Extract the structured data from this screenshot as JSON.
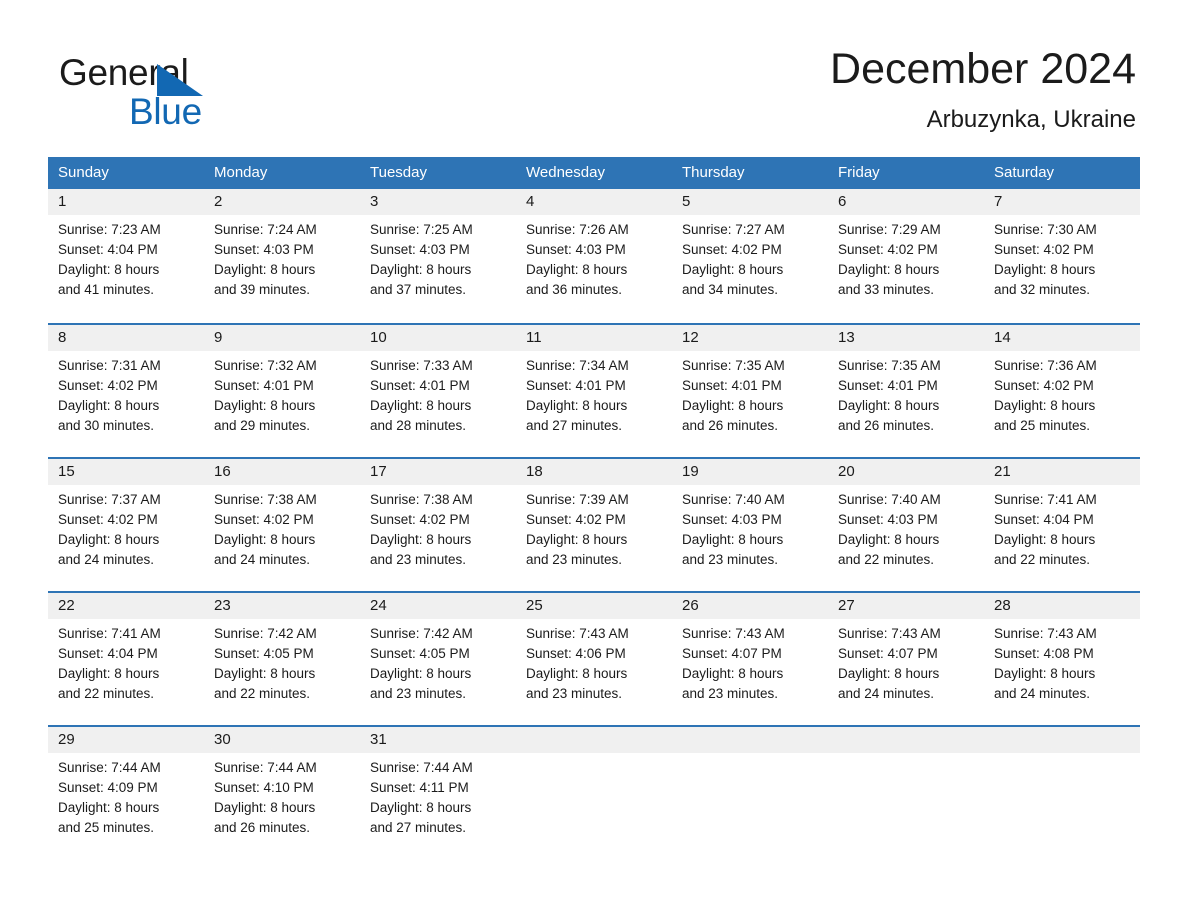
{
  "brand": {
    "name_part1": "General",
    "name_part2": "Blue",
    "triangle_color": "#1268b3",
    "logo_icon": "triangle-flag-icon"
  },
  "header": {
    "title": "December 2024",
    "subtitle": "Arbuzynka, Ukraine"
  },
  "calendar": {
    "header_bg": "#2e74b5",
    "header_text_color": "#ffffff",
    "daynumber_band_bg": "#f0f0f0",
    "weekdays": [
      "Sunday",
      "Monday",
      "Tuesday",
      "Wednesday",
      "Thursday",
      "Friday",
      "Saturday"
    ],
    "weeks": [
      [
        {
          "day": "1",
          "sunrise": "Sunrise: 7:23 AM",
          "sunset": "Sunset: 4:04 PM",
          "daylight_line1": "Daylight: 8 hours",
          "daylight_line2": "and 41 minutes."
        },
        {
          "day": "2",
          "sunrise": "Sunrise: 7:24 AM",
          "sunset": "Sunset: 4:03 PM",
          "daylight_line1": "Daylight: 8 hours",
          "daylight_line2": "and 39 minutes."
        },
        {
          "day": "3",
          "sunrise": "Sunrise: 7:25 AM",
          "sunset": "Sunset: 4:03 PM",
          "daylight_line1": "Daylight: 8 hours",
          "daylight_line2": "and 37 minutes."
        },
        {
          "day": "4",
          "sunrise": "Sunrise: 7:26 AM",
          "sunset": "Sunset: 4:03 PM",
          "daylight_line1": "Daylight: 8 hours",
          "daylight_line2": "and 36 minutes."
        },
        {
          "day": "5",
          "sunrise": "Sunrise: 7:27 AM",
          "sunset": "Sunset: 4:02 PM",
          "daylight_line1": "Daylight: 8 hours",
          "daylight_line2": "and 34 minutes."
        },
        {
          "day": "6",
          "sunrise": "Sunrise: 7:29 AM",
          "sunset": "Sunset: 4:02 PM",
          "daylight_line1": "Daylight: 8 hours",
          "daylight_line2": "and 33 minutes."
        },
        {
          "day": "7",
          "sunrise": "Sunrise: 7:30 AM",
          "sunset": "Sunset: 4:02 PM",
          "daylight_line1": "Daylight: 8 hours",
          "daylight_line2": "and 32 minutes."
        }
      ],
      [
        {
          "day": "8",
          "sunrise": "Sunrise: 7:31 AM",
          "sunset": "Sunset: 4:02 PM",
          "daylight_line1": "Daylight: 8 hours",
          "daylight_line2": "and 30 minutes."
        },
        {
          "day": "9",
          "sunrise": "Sunrise: 7:32 AM",
          "sunset": "Sunset: 4:01 PM",
          "daylight_line1": "Daylight: 8 hours",
          "daylight_line2": "and 29 minutes."
        },
        {
          "day": "10",
          "sunrise": "Sunrise: 7:33 AM",
          "sunset": "Sunset: 4:01 PM",
          "daylight_line1": "Daylight: 8 hours",
          "daylight_line2": "and 28 minutes."
        },
        {
          "day": "11",
          "sunrise": "Sunrise: 7:34 AM",
          "sunset": "Sunset: 4:01 PM",
          "daylight_line1": "Daylight: 8 hours",
          "daylight_line2": "and 27 minutes."
        },
        {
          "day": "12",
          "sunrise": "Sunrise: 7:35 AM",
          "sunset": "Sunset: 4:01 PM",
          "daylight_line1": "Daylight: 8 hours",
          "daylight_line2": "and 26 minutes."
        },
        {
          "day": "13",
          "sunrise": "Sunrise: 7:35 AM",
          "sunset": "Sunset: 4:01 PM",
          "daylight_line1": "Daylight: 8 hours",
          "daylight_line2": "and 26 minutes."
        },
        {
          "day": "14",
          "sunrise": "Sunrise: 7:36 AM",
          "sunset": "Sunset: 4:02 PM",
          "daylight_line1": "Daylight: 8 hours",
          "daylight_line2": "and 25 minutes."
        }
      ],
      [
        {
          "day": "15",
          "sunrise": "Sunrise: 7:37 AM",
          "sunset": "Sunset: 4:02 PM",
          "daylight_line1": "Daylight: 8 hours",
          "daylight_line2": "and 24 minutes."
        },
        {
          "day": "16",
          "sunrise": "Sunrise: 7:38 AM",
          "sunset": "Sunset: 4:02 PM",
          "daylight_line1": "Daylight: 8 hours",
          "daylight_line2": "and 24 minutes."
        },
        {
          "day": "17",
          "sunrise": "Sunrise: 7:38 AM",
          "sunset": "Sunset: 4:02 PM",
          "daylight_line1": "Daylight: 8 hours",
          "daylight_line2": "and 23 minutes."
        },
        {
          "day": "18",
          "sunrise": "Sunrise: 7:39 AM",
          "sunset": "Sunset: 4:02 PM",
          "daylight_line1": "Daylight: 8 hours",
          "daylight_line2": "and 23 minutes."
        },
        {
          "day": "19",
          "sunrise": "Sunrise: 7:40 AM",
          "sunset": "Sunset: 4:03 PM",
          "daylight_line1": "Daylight: 8 hours",
          "daylight_line2": "and 23 minutes."
        },
        {
          "day": "20",
          "sunrise": "Sunrise: 7:40 AM",
          "sunset": "Sunset: 4:03 PM",
          "daylight_line1": "Daylight: 8 hours",
          "daylight_line2": "and 22 minutes."
        },
        {
          "day": "21",
          "sunrise": "Sunrise: 7:41 AM",
          "sunset": "Sunset: 4:04 PM",
          "daylight_line1": "Daylight: 8 hours",
          "daylight_line2": "and 22 minutes."
        }
      ],
      [
        {
          "day": "22",
          "sunrise": "Sunrise: 7:41 AM",
          "sunset": "Sunset: 4:04 PM",
          "daylight_line1": "Daylight: 8 hours",
          "daylight_line2": "and 22 minutes."
        },
        {
          "day": "23",
          "sunrise": "Sunrise: 7:42 AM",
          "sunset": "Sunset: 4:05 PM",
          "daylight_line1": "Daylight: 8 hours",
          "daylight_line2": "and 22 minutes."
        },
        {
          "day": "24",
          "sunrise": "Sunrise: 7:42 AM",
          "sunset": "Sunset: 4:05 PM",
          "daylight_line1": "Daylight: 8 hours",
          "daylight_line2": "and 23 minutes."
        },
        {
          "day": "25",
          "sunrise": "Sunrise: 7:43 AM",
          "sunset": "Sunset: 4:06 PM",
          "daylight_line1": "Daylight: 8 hours",
          "daylight_line2": "and 23 minutes."
        },
        {
          "day": "26",
          "sunrise": "Sunrise: 7:43 AM",
          "sunset": "Sunset: 4:07 PM",
          "daylight_line1": "Daylight: 8 hours",
          "daylight_line2": "and 23 minutes."
        },
        {
          "day": "27",
          "sunrise": "Sunrise: 7:43 AM",
          "sunset": "Sunset: 4:07 PM",
          "daylight_line1": "Daylight: 8 hours",
          "daylight_line2": "and 24 minutes."
        },
        {
          "day": "28",
          "sunrise": "Sunrise: 7:43 AM",
          "sunset": "Sunset: 4:08 PM",
          "daylight_line1": "Daylight: 8 hours",
          "daylight_line2": "and 24 minutes."
        }
      ],
      [
        {
          "day": "29",
          "sunrise": "Sunrise: 7:44 AM",
          "sunset": "Sunset: 4:09 PM",
          "daylight_line1": "Daylight: 8 hours",
          "daylight_line2": "and 25 minutes."
        },
        {
          "day": "30",
          "sunrise": "Sunrise: 7:44 AM",
          "sunset": "Sunset: 4:10 PM",
          "daylight_line1": "Daylight: 8 hours",
          "daylight_line2": "and 26 minutes."
        },
        {
          "day": "31",
          "sunrise": "Sunrise: 7:44 AM",
          "sunset": "Sunset: 4:11 PM",
          "daylight_line1": "Daylight: 8 hours",
          "daylight_line2": "and 27 minutes."
        },
        {
          "day": "",
          "sunrise": "",
          "sunset": "",
          "daylight_line1": "",
          "daylight_line2": ""
        },
        {
          "day": "",
          "sunrise": "",
          "sunset": "",
          "daylight_line1": "",
          "daylight_line2": ""
        },
        {
          "day": "",
          "sunrise": "",
          "sunset": "",
          "daylight_line1": "",
          "daylight_line2": ""
        },
        {
          "day": "",
          "sunrise": "",
          "sunset": "",
          "daylight_line1": "",
          "daylight_line2": ""
        }
      ]
    ]
  }
}
